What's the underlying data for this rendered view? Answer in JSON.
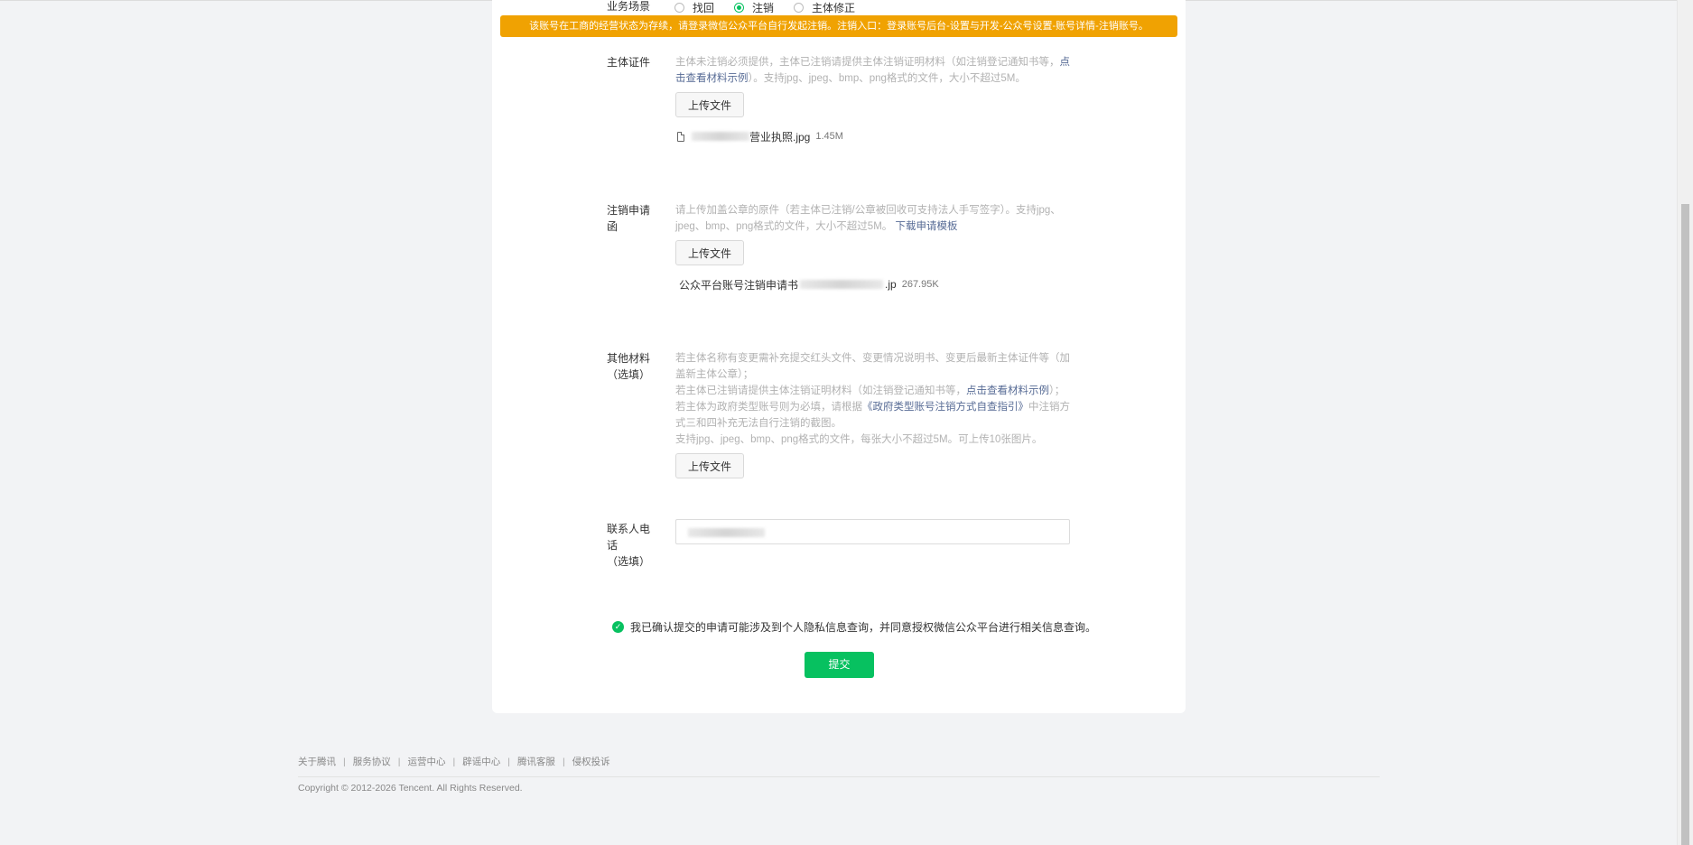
{
  "scene": {
    "label": "业务场景",
    "options": [
      "找回",
      "注销",
      "主体修正"
    ],
    "selected": "注销"
  },
  "banner": "该账号在工商的经营状态为存续，请登录微信公众平台自行发起注销。注销入口：登录账号后台-设置与开发-公众号设置-账号详情-注销账号。",
  "subject_cert": {
    "label": "主体证件",
    "desc_pre": "主体未注销必须提供，主体已注销请提供主体注销证明材料（如注销登记通知书等，",
    "desc_link": "点击查看材料示例",
    "desc_post": "）。支持jpg、jpeg、bmp、png格式的文件，大小不超过5M。",
    "upload_label": "上传文件",
    "file_name": "营业执照.jpg",
    "file_size": "1.45M"
  },
  "cancel_letter": {
    "label": "注销申请函",
    "desc": "请上传加盖公章的原件（若主体已注销/公章被回收可支持法人手写签字）。支持jpg、jpeg、bmp、png格式的文件，大小不超过5M。",
    "desc_link": "下载申请模板",
    "upload_label": "上传文件",
    "file_name_prefix": "公众平台账号注销申请书",
    "file_name_suffix": ".jp",
    "file_size": "267.95K"
  },
  "other_materials": {
    "label": "其他材料",
    "optional": "（选填）",
    "line1": "若主体名称有变更需补充提交红头文件、变更情况说明书、变更后最新主体证件等（加盖新主体公章）；",
    "line2_pre": "若主体已注销请提供主体注销证明材料（如注销登记通知书等，",
    "line2_link": "点击查看材料示例",
    "line2_post": "）；",
    "line3_pre": "若主体为政府类型账号则为必填，请根据",
    "line3_link": "《政府类型账号注销方式自查指引》",
    "line3_post": "中注销方式三和四补充无法自行注销的截图。",
    "line4": "支持jpg、jpeg、bmp、png格式的文件，每张大小不超过5M。可上传10张图片。",
    "upload_label": "上传文件"
  },
  "contact": {
    "label": "联系人电话",
    "optional": "（选填）"
  },
  "confirm_text": "我已确认提交的申请可能涉及到个人隐私信息查询，并同意授权微信公众平台进行相关信息查询。",
  "submit_label": "提交",
  "footer": {
    "links": [
      "关于腾讯",
      "服务协议",
      "运营中心",
      "辟谣中心",
      "腾讯客服",
      "侵权投诉"
    ],
    "copyright": "Copyright © 2012-2026 Tencent. All Rights Reserved."
  },
  "colors": {
    "accent": "#07c160",
    "banner": "#f0a202",
    "link": "#576b95"
  }
}
